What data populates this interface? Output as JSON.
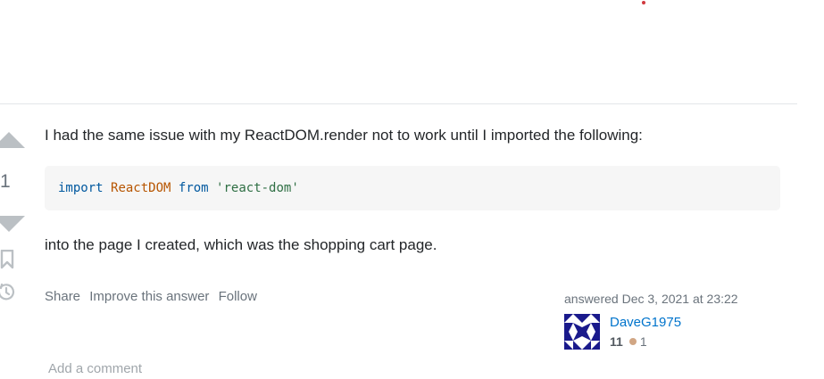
{
  "answer": {
    "vote_count": "1",
    "paragraphs": [
      "I had the same issue with my ReactDOM.render not to work until I imported the following:",
      "into the page I created, which was the shopping cart page."
    ],
    "code": {
      "kw_import": "import",
      "identifier": "ReactDOM",
      "kw_from": "from",
      "string": "'react-dom'"
    }
  },
  "post_menu": {
    "share": "Share",
    "improve": "Improve this answer",
    "follow": "Follow"
  },
  "signature": {
    "action": "answered",
    "date": "Dec 3, 2021 at 23:22",
    "user_name": "DaveG1975",
    "reputation": "11",
    "bronze_badges": "1"
  },
  "comments": {
    "add_comment": "Add a comment"
  },
  "icons": {
    "vote_up": "triangle-up-icon",
    "vote_down": "triangle-down-icon",
    "bookmark": "bookmark-icon",
    "history": "history-icon"
  },
  "colors": {
    "link": "#0074cc",
    "muted": "#6a737c",
    "bronze": "#d1a684",
    "code_bg": "#f6f6f6"
  }
}
